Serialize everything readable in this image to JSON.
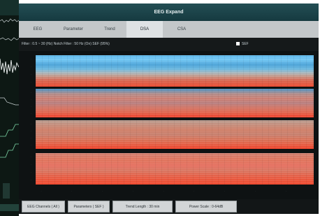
{
  "window": {
    "title": "EEG Expand"
  },
  "tabs": [
    {
      "label": "EEG",
      "active": false
    },
    {
      "label": "Parameter",
      "active": false
    },
    {
      "label": "Trend",
      "active": false
    },
    {
      "label": "DSA",
      "active": true
    },
    {
      "label": "CSA",
      "active": false
    }
  ],
  "filter_bar": {
    "text": "Filter : 0.5 ~ 30 (Hz)    Notch Filter : 50 Hz (On)    SEF (95%)",
    "set_legend": "SEF"
  },
  "dsa_panels": [
    {
      "channel_index": 1
    },
    {
      "channel_index": 2
    },
    {
      "channel_index": 3
    },
    {
      "channel_index": 4
    }
  ],
  "bottom_buttons": [
    {
      "label": "EEG Channels ( All )"
    },
    {
      "label": "Parameters ( SEF )"
    },
    {
      "label": "Trend Length : 30 min"
    },
    {
      "label": "Power Scale : 0-64dB"
    }
  ],
  "colors": {
    "low_power": "#5cb7ea",
    "high_power": "#ef3f2a",
    "title_bar": "#1e4a50"
  },
  "icons": [
    "eeg-waveform-icon"
  ]
}
